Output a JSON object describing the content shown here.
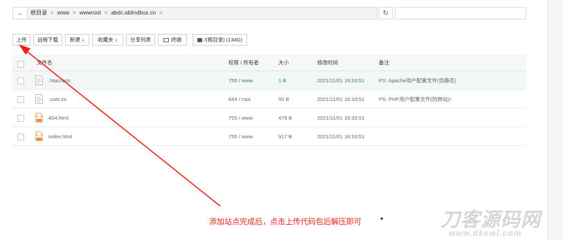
{
  "path_bar": {
    "back_icon": "arrow-left-icon",
    "crumbs": [
      "根目录",
      "www",
      "wwwroot",
      "abdc.ablindbox.cn"
    ]
  },
  "toolbar": {
    "upload": "上传",
    "remote_download": "远程下载",
    "new": "新建",
    "favorites": "收藏夹",
    "share_list": "分享列表",
    "terminal": "终端",
    "disk": "/(根目录) (134G)"
  },
  "table": {
    "headers": [
      "文件名",
      "权限 / 所有者",
      "大小",
      "修改时间",
      "备注"
    ],
    "rows": [
      {
        "name": ".htaccess",
        "perm": "755 / www",
        "size": "1 B",
        "mtime": "2021/11/01 16:33:51",
        "note": "PS: Apache用户配置文件(伪静态)",
        "icon": "text-file-icon"
      },
      {
        "name": ".user.ini",
        "perm": "644 / root",
        "size": "50 B",
        "mtime": "2021/11/01 16:33:51",
        "note": "PS: PHP用户配置文件(防跨站)!",
        "icon": "text-file-icon"
      },
      {
        "name": "404.html",
        "perm": "755 / www",
        "size": "479 B",
        "mtime": "2021/11/01 16:33:51",
        "note": "",
        "icon": "html-file-icon"
      },
      {
        "name": "index.html",
        "perm": "755 / www",
        "size": "917 B",
        "mtime": "2021/11/01 16:33:51",
        "note": "",
        "icon": "html-file-icon"
      }
    ]
  },
  "annotation": {
    "text": "添加站点完成后，点击上传代码包后解压即可",
    "color": "#e8231a"
  },
  "watermark": {
    "title": "刀客源码网",
    "url": "www.dkewl.com"
  },
  "colors": {
    "highlight_row": "#f2f8f5",
    "border": "#dcdcdc",
    "arrow": "#e8231a"
  }
}
